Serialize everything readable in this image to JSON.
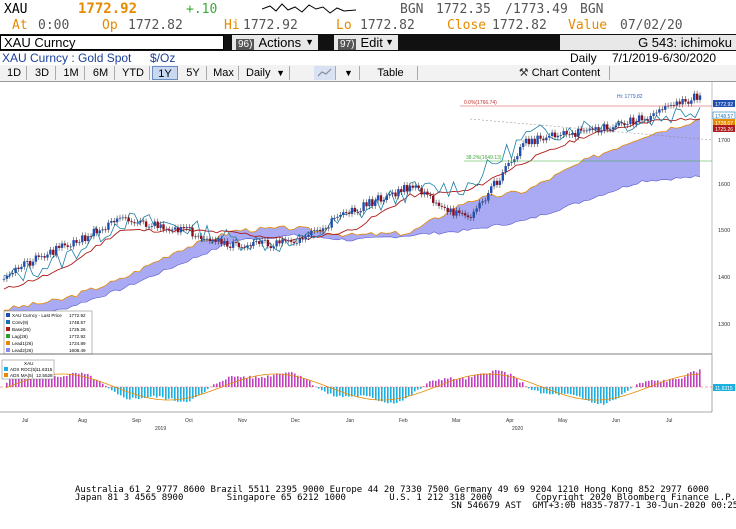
{
  "ticker": {
    "symbol": "XAU",
    "last": "1772.92",
    "change": "+.10",
    "bgn_label": "BGN",
    "bid_ask": "1772.35",
    "ask": "1773.49",
    "bgn_label2": "BGN",
    "at_label": "At",
    "at_value": "0:00",
    "op_label": "Op",
    "op_value": "1772.82",
    "hi_label": "Hi",
    "hi_value": "1772.92",
    "lo_label": "Lo",
    "lo_value": "1772.82",
    "close_label": "Close",
    "close_value": "1772.82",
    "value_label": "Value",
    "value_date": "07/02/20"
  },
  "titlebar": {
    "security": "XAU Curncy",
    "actions_num": "96)",
    "actions_label": "Actions",
    "edit_num": "97)",
    "edit_label": "Edit",
    "chart_name": "G 543: ichimoku"
  },
  "subline": {
    "desc": "XAU Curncy : Gold Spot",
    "unit": "$/Oz",
    "period": "Daily",
    "range": "7/1/2019-6/30/2020"
  },
  "toolbar": {
    "ranges": [
      "1D",
      "3D",
      "1M",
      "6M",
      "YTD",
      "1Y",
      "5Y",
      "Max"
    ],
    "selected_range": "1Y",
    "freq": "Daily",
    "table_label": "Table",
    "chart_content_label": "Chart Content"
  },
  "legend": [
    {
      "label": "XAU Curncy - Last Price",
      "value": "1772.92",
      "color": "#1f4fb0"
    },
    {
      "label": "Conv(9)",
      "value": "1748.57",
      "color": "#1a6fb5"
    },
    {
      "label": "Base(26)",
      "value": "1725.26",
      "color": "#b01a1a"
    },
    {
      "label": "Lag(26)",
      "value": "1772.92",
      "color": "#2aa02a"
    },
    {
      "label": "Lead1(26)",
      "value": "1724.89",
      "color": "#e68a00"
    },
    {
      "label": "Lead2(26)",
      "value": "1608.49",
      "color": "#8888ee"
    }
  ],
  "price_axis": [
    "1700",
    "1600",
    "1500",
    "1400",
    "1300"
  ],
  "price_tags": [
    {
      "value": "1772.92",
      "color": "#1f4fb0"
    },
    {
      "value": "1748.57",
      "color": "#1a6fb5"
    },
    {
      "value": "1728.07",
      "color": "#e68a00"
    },
    {
      "value": "1725.26",
      "color": "#b01a1a"
    }
  ],
  "annotations": {
    "hi_label": "Hi: 1779.82",
    "fib1": "0.0%(1766.74)",
    "fib2": "38.2%(1649.13)"
  },
  "adx": {
    "title": "XAU",
    "line1_label": "ADX ROC(5)",
    "line1_value": "11.6315",
    "line2_label": "ADX MA(5)",
    "line2_value": "12.5528",
    "tag": "11.6315"
  },
  "x_months": [
    "Jul",
    "Aug",
    "Sep",
    "Oct",
    "Nov",
    "Dec",
    "Jan",
    "Feb",
    "Mar",
    "Apr",
    "May",
    "Jun",
    "Jul"
  ],
  "x_years": [
    "2019",
    "2020"
  ],
  "footer": {
    "line1": "Australia 61 2 9777 8600 Brazil 5511 2395 9000 Europe 44 20 7330 7500 Germany 49 69 9204 1210 Hong Kong 852 2977 6000",
    "line2": "Japan 81 3 4565 8900        Singapore 65 6212 1000        U.S. 1 212 318 2000        Copyright 2020 Bloomberg Finance L.P.",
    "line3": "SN 546679 AST  GMT+3:00 H835-7877-1 30-Jun-2020 00:25:00"
  },
  "chart_data": {
    "type": "line",
    "title": "XAU Curncy : Gold Spot",
    "ylabel": "$/Oz",
    "ylim": [
      1250,
      1800
    ],
    "x": [
      "Jul 2019",
      "Aug 2019",
      "Sep 2019",
      "Oct 2019",
      "Nov 2019",
      "Dec 2019",
      "Jan 2020",
      "Feb 2020",
      "Mar 2020",
      "Apr 2020",
      "May 2020",
      "Jun 2020",
      "Jul 2020"
    ],
    "series": [
      {
        "name": "XAU Curncy - Last Price",
        "values": [
          1410,
          1465,
          1520,
          1505,
          1470,
          1475,
          1540,
          1590,
          1520,
          1680,
          1700,
          1725,
          1772.92
        ]
      },
      {
        "name": "Conv(9)",
        "values": [
          1400,
          1440,
          1520,
          1510,
          1480,
          1470,
          1530,
          1580,
          1590,
          1690,
          1710,
          1720,
          1748.57
        ]
      },
      {
        "name": "Base(26)",
        "values": [
          1380,
          1420,
          1500,
          1500,
          1495,
          1480,
          1500,
          1570,
          1580,
          1640,
          1690,
          1720,
          1725.26
        ]
      },
      {
        "name": "Lead1(26)",
        "values": [
          1340,
          1360,
          1400,
          1460,
          1500,
          1505,
          1490,
          1495,
          1560,
          1580,
          1640,
          1690,
          1724.89
        ]
      },
      {
        "name": "Lead2(26)",
        "values": [
          1320,
          1340,
          1380,
          1430,
          1480,
          1490,
          1480,
          1490,
          1500,
          1520,
          1560,
          1600,
          1608.49
        ]
      }
    ],
    "grid": false,
    "legend": "bottom-left"
  }
}
